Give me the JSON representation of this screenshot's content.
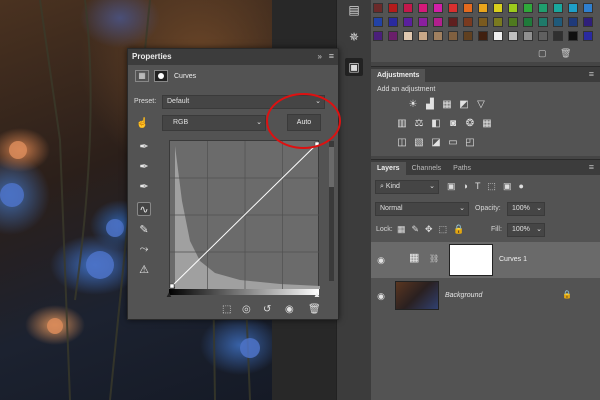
{
  "properties": {
    "title": "Properties",
    "type_label": "Curves",
    "preset_label": "Preset:",
    "preset_value": "Default",
    "channel_value": "RGB",
    "auto_button": "Auto"
  },
  "adjustments": {
    "tab": "Adjustments",
    "add_label": "Add an adjustment"
  },
  "layers": {
    "tabs": [
      "Layers",
      "Channels",
      "Paths"
    ],
    "filter_kind": "Kind",
    "blend_mode": "Normal",
    "opacity_label": "Opacity:",
    "opacity_value": "100%",
    "lock_label": "Lock:",
    "fill_label": "Fill:",
    "fill_value": "100%",
    "items": [
      {
        "name": "Curves 1"
      },
      {
        "name": "Background"
      }
    ]
  },
  "colors": {
    "accent_circle": "#dd1111",
    "selected_layer": "#6a6a6a"
  },
  "swatch_colors": [
    "#6b2a2a",
    "#b31b1b",
    "#c4184b",
    "#d4197a",
    "#d21fa8",
    "#d82f2f",
    "#e46a1e",
    "#e9a51c",
    "#d9cf1c",
    "#9ccb1c",
    "#2fa93a",
    "#1f9e6e",
    "#19a89e",
    "#1e9fc9",
    "#2f7fcf",
    "#2242a6",
    "#2a2a9e",
    "#5a1f9e",
    "#8a1f9e",
    "#b21f8e",
    "#5f1f1f",
    "#7a3a1f",
    "#7a5a1f",
    "#7a7a1f",
    "#4f7a1f",
    "#1f7a3a",
    "#1f7a6a",
    "#1f5a7a",
    "#1f3a7a",
    "#2f1f7a",
    "#4a1f7a",
    "#6a1f6a",
    "#e0c8b0",
    "#c8a888",
    "#a08060",
    "#806040",
    "#604020",
    "#402010",
    "#f0f0f0",
    "#c0c0c0",
    "#909090",
    "#606060",
    "#303030",
    "#101010",
    "#2a2aa0"
  ]
}
